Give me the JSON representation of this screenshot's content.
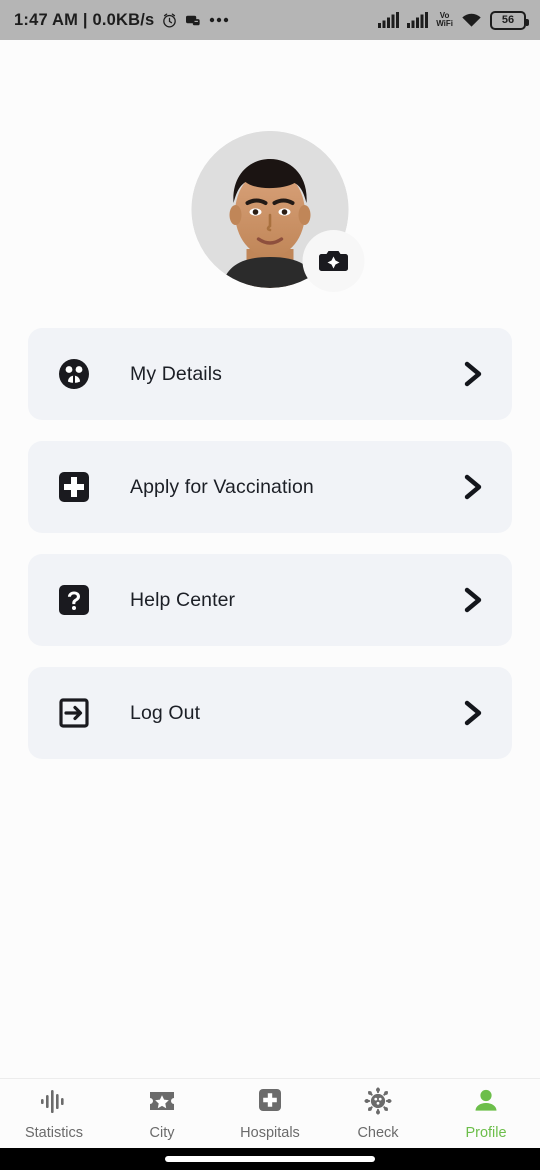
{
  "status_bar": {
    "time_and_network": "1:47 AM | 0.0KB/s",
    "alarm_icon": "alarm-clock-icon",
    "message_icon": "message-icon",
    "more_icon": "more-dots-icon",
    "signal_1_icon": "signal-bars-icon",
    "signal_2_icon": "signal-bars-icon",
    "vowifi_top": "Vo",
    "vowifi_bottom": "WiFi",
    "wifi_icon": "wifi-icon",
    "battery_level": "56",
    "bg_color": "#b5b5b5"
  },
  "profile": {
    "avatar_icon": "user-avatar-photo",
    "camera_badge_icon": "camera-icon"
  },
  "menu": {
    "items": [
      {
        "label": "My Details",
        "icon": "people-circle-icon",
        "chevron": "chevron-right-icon"
      },
      {
        "label": "Apply for Vaccination",
        "icon": "medical-cross-icon",
        "chevron": "chevron-right-icon"
      },
      {
        "label": "Help Center",
        "icon": "question-mark-icon",
        "chevron": "chevron-right-icon"
      },
      {
        "label": "Log Out",
        "icon": "logout-arrow-icon",
        "chevron": "chevron-right-icon"
      }
    ],
    "card_color": "#f1f3f7"
  },
  "bottom_nav": {
    "active_color": "#6cbe4a",
    "inactive_color": "#6b6b6b",
    "tabs": [
      {
        "label": "Statistics",
        "icon": "waveform-icon",
        "active": false
      },
      {
        "label": "City",
        "icon": "star-ticket-icon",
        "active": false
      },
      {
        "label": "Hospitals",
        "icon": "hospital-cross-icon",
        "active": false
      },
      {
        "label": "Check",
        "icon": "virus-icon",
        "active": false
      },
      {
        "label": "Profile",
        "icon": "person-icon",
        "active": true
      }
    ]
  }
}
